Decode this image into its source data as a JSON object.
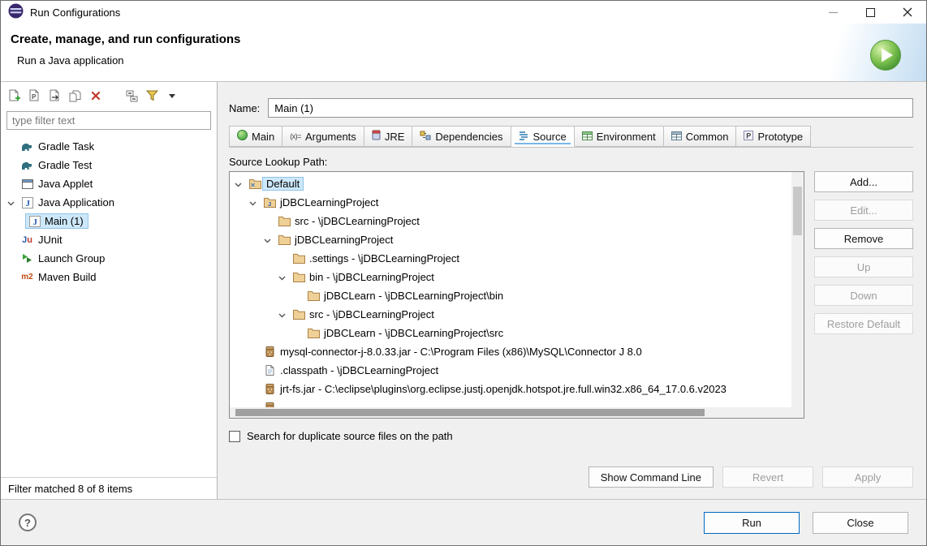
{
  "window": {
    "title": "Run Configurations"
  },
  "header": {
    "title": "Create, manage, and run configurations",
    "subtitle": "Run a Java application"
  },
  "left_panel": {
    "toolbar_icons": [
      "new-launch-config",
      "new-prototype",
      "export-launch-configs",
      "duplicate-config",
      "delete-config",
      "collapse-all",
      "filter-configs",
      "view-menu"
    ],
    "filter_placeholder": "type filter text",
    "tree": [
      {
        "label": "Gradle Task",
        "icon": "gradle"
      },
      {
        "label": "Gradle Test",
        "icon": "gradle"
      },
      {
        "label": "Java Applet",
        "icon": "java-applet"
      },
      {
        "label": "Java Application",
        "icon": "java-application",
        "expanded": true
      },
      {
        "label": "Main (1)",
        "icon": "java-application",
        "selected": true,
        "indent": 1
      },
      {
        "label": "JUnit",
        "icon": "junit"
      },
      {
        "label": "Launch Group",
        "icon": "launch-group"
      },
      {
        "label": "Maven Build",
        "icon": "maven"
      }
    ],
    "status": "Filter matched 8 of 8 items"
  },
  "config": {
    "name_label": "Name:",
    "name_value": "Main (1)",
    "tabs": [
      {
        "label": "Main",
        "selected": false
      },
      {
        "label": "Arguments",
        "selected": false
      },
      {
        "label": "JRE",
        "selected": false
      },
      {
        "label": "Dependencies",
        "selected": false
      },
      {
        "label": "Source",
        "selected": true
      },
      {
        "label": "Environment",
        "selected": false
      },
      {
        "label": "Common",
        "selected": false
      },
      {
        "label": "Prototype",
        "selected": false
      }
    ],
    "source_tab": {
      "lookup_label": "Source Lookup Path:",
      "rows": [
        {
          "label": "Default",
          "level": 0,
          "expanded": true,
          "icon": "folder",
          "selected": true
        },
        {
          "label": "jDBCLearningProject",
          "level": 1,
          "expanded": true,
          "icon": "project-folder"
        },
        {
          "label": "src - \\jDBCLearningProject",
          "level": 2,
          "icon": "folder"
        },
        {
          "label": "jDBCLearningProject",
          "level": 2,
          "expanded": true,
          "icon": "folder"
        },
        {
          "label": ".settings - \\jDBCLearningProject",
          "level": 3,
          "icon": "folder"
        },
        {
          "label": "bin - \\jDBCLearningProject",
          "level": 3,
          "expanded": true,
          "icon": "folder"
        },
        {
          "label": "jDBCLearn - \\jDBCLearningProject\\bin",
          "level": 4,
          "icon": "folder"
        },
        {
          "label": "src - \\jDBCLearningProject",
          "level": 3,
          "expanded": true,
          "icon": "folder"
        },
        {
          "label": "jDBCLearn - \\jDBCLearningProject\\src",
          "level": 4,
          "icon": "folder"
        },
        {
          "label": "mysql-connector-j-8.0.33.jar - C:\\Program Files (x86)\\MySQL\\Connector J 8.0",
          "level": 1,
          "icon": "jar"
        },
        {
          "label": ".classpath - \\jDBCLearningProject",
          "level": 1,
          "icon": "file"
        },
        {
          "label": "jrt-fs.jar - C:\\eclipse\\plugins\\org.eclipse.justj.openjdk.hotspot.jre.full.win32.x86_64_17.0.6.v2023",
          "level": 1,
          "icon": "jar"
        },
        {
          "label": "",
          "level": 1,
          "icon": "jar",
          "partial": true
        }
      ],
      "buttons": [
        {
          "label": "Add...",
          "enabled": true
        },
        {
          "label": "Edit...",
          "enabled": false
        },
        {
          "label": "Remove",
          "enabled": true
        },
        {
          "label": "Up",
          "enabled": false
        },
        {
          "label": "Down",
          "enabled": false
        },
        {
          "label": "Restore Default",
          "enabled": false
        }
      ],
      "checkbox_label": "Search for duplicate source files on the path",
      "checkbox_checked": false
    },
    "actions": [
      {
        "label": "Show Command Line",
        "enabled": true
      },
      {
        "label": "Revert",
        "enabled": false
      },
      {
        "label": "Apply",
        "enabled": false
      }
    ]
  },
  "footer": {
    "help": "?",
    "run": "Run",
    "close": "Close"
  }
}
